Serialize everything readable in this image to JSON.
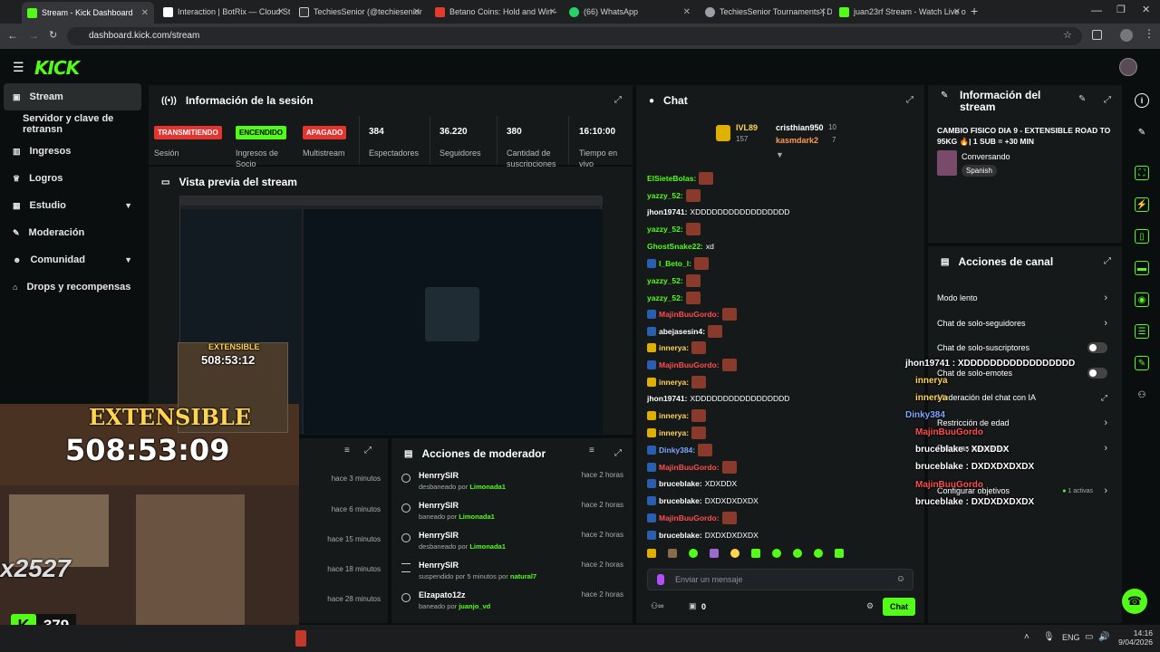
{
  "browser": {
    "tabs": [
      {
        "label": "Stream - Kick Dashboard",
        "color": "#53fc18"
      },
      {
        "label": "Interaction | BotRix — Cloud St",
        "color": "#ffffff"
      },
      {
        "label": "TechiesSenior (@techiesenior",
        "color": "#000000"
      },
      {
        "label": "Betano Coins: Hold and Win -",
        "color": "#e23b2b"
      },
      {
        "label": "(66) WhatsApp",
        "color": "#25d366"
      },
      {
        "label": "TechiesSenior Tournaments | D",
        "color": "#9aa0a6"
      },
      {
        "label": "juan23rf Stream - Watch Live o",
        "color": "#53fc18"
      }
    ],
    "url": "dashboard.kick.com/stream"
  },
  "brand": {
    "logo": "KICK",
    "accent": "#53fc18"
  },
  "sidebar": {
    "items": [
      {
        "label": "Stream",
        "icon": "stream-icon"
      },
      {
        "label": "Servidor y clave de retransn",
        "icon": ""
      },
      {
        "label": "Ingresos",
        "icon": "chart-icon"
      },
      {
        "label": "Logros",
        "icon": "trophy-icon"
      },
      {
        "label": "Estudio",
        "icon": "grid-icon"
      },
      {
        "label": "Moderación",
        "icon": "wrench-icon"
      },
      {
        "label": "Comunidad",
        "icon": "users-icon"
      },
      {
        "label": "Drops y recompensas",
        "icon": "gift-icon"
      }
    ]
  },
  "session": {
    "title": "Información de la sesión",
    "badges": [
      {
        "badge": "TRANSMITIENDO",
        "label": "Sesión"
      },
      {
        "badge": "ENCENDIDO",
        "label": "Ingresos de Socio"
      },
      {
        "badge": "APAGADO",
        "label": "Multistream"
      }
    ],
    "stats": [
      {
        "value": "384",
        "label": "Espectadores"
      },
      {
        "value": "36.220",
        "label": "Seguidores"
      },
      {
        "value": "380",
        "label": "Cantidad de suscripciones"
      },
      {
        "value": "16:10:00",
        "label": "Tiempo en vivo"
      }
    ]
  },
  "preview": {
    "title": "Vista previa del stream"
  },
  "overlay": {
    "timer_small": "508:53:12",
    "extensible": "EXTENSIBLE",
    "timer_big": "508:53:09",
    "counter": "x2527",
    "kick_count": "379",
    "float_chat": [
      {
        "user": "jhon19741",
        "msg": "XDDDDDDDDDDDDDDDDD",
        "color": "#ffffff"
      },
      {
        "user": "innerya",
        "msg": "",
        "color": "#ffd54f"
      },
      {
        "user": "innerya",
        "msg": "",
        "color": "#ffd54f"
      },
      {
        "user": "Dinky384",
        "msg": "",
        "color": "#7ea6ff"
      },
      {
        "user": "MajinBuuGordo",
        "msg": "",
        "color": "#ff4d4d"
      },
      {
        "user": "bruceblake",
        "msg": "XDXDDX",
        "color": "#ffffff"
      },
      {
        "user": "bruceblake",
        "msg": "DXDXDXDXDX",
        "color": "#ffffff"
      },
      {
        "user": "MajinBuuGordo",
        "msg": "",
        "color": "#ff4d4d"
      },
      {
        "user": "bruceblake",
        "msg": "DXDXDXDXDX",
        "color": "#ffffff"
      }
    ]
  },
  "timeline": {
    "rows": [
      "hace 3 minutos",
      "hace 6 minutos",
      "hace 15 minutos",
      "hace 18 minutos",
      "hace 28 minutos"
    ]
  },
  "modactions": {
    "title": "Acciones de moderador",
    "rows": [
      {
        "name": "HenrrySIR",
        "desc": "desbaneado por",
        "by": "Limonada1",
        "time": "hace 2 horas"
      },
      {
        "name": "HenrrySIR",
        "desc": "baneado por",
        "by": "Limonada1",
        "time": "hace 2 horas"
      },
      {
        "name": "HenrrySIR",
        "desc": "desbaneado por",
        "by": "Limonada1",
        "time": "hace 2 horas"
      },
      {
        "name": "HenrrySIR",
        "desc": "suspendido por 5 minutos por",
        "by": "natural7",
        "time": "hace 2 horas"
      },
      {
        "name": "Elzapato12z",
        "desc": "baneado por",
        "by": "juanjo_vd",
        "time": "hace 2 horas"
      }
    ]
  },
  "chat": {
    "title": "Chat",
    "top": {
      "level": "IVL89",
      "level_sub": "157",
      "user1": "cristhian950",
      "user1_n": "10",
      "user2": "kasmdark2",
      "user2_n": "7"
    },
    "messages": [
      {
        "user": "ElSieteBolas:",
        "msg": "",
        "color": "#53fc18"
      },
      {
        "user": "yazzy_52:",
        "msg": "",
        "color": "#53fc18"
      },
      {
        "user": "jhon19741:",
        "msg": "XDDDDDDDDDDDDDDDDD",
        "color": "#ffffff"
      },
      {
        "user": "yazzy_52:",
        "msg": "",
        "color": "#53fc18"
      },
      {
        "user": "GhostSnake22:",
        "msg": "xd",
        "color": "#53fc18"
      },
      {
        "user": "I_Beto_I:",
        "msg": "",
        "color": "#53fc18"
      },
      {
        "user": "yazzy_52:",
        "msg": "",
        "color": "#53fc18"
      },
      {
        "user": "yazzy_52:",
        "msg": "",
        "color": "#53fc18"
      },
      {
        "user": "MajinBuuGordo:",
        "msg": "",
        "color": "#ff4d4d"
      },
      {
        "user": "abejasesin4:",
        "msg": "",
        "color": "#ffffff"
      },
      {
        "user": "innerya:",
        "msg": "",
        "color": "#ffd54f"
      },
      {
        "user": "MajinBuuGordo:",
        "msg": "",
        "color": "#ff4d4d"
      },
      {
        "user": "innerya:",
        "msg": "",
        "color": "#ffd54f"
      },
      {
        "user": "jhon19741:",
        "msg": "XDDDDDDDDDDDDDDDDD",
        "color": "#ffffff"
      },
      {
        "user": "innerya:",
        "msg": "",
        "color": "#ffd54f"
      },
      {
        "user": "innerya:",
        "msg": "",
        "color": "#ffd54f"
      },
      {
        "user": "Dinky384:",
        "msg": "",
        "color": "#7ea6ff"
      },
      {
        "user": "MajinBuuGordo:",
        "msg": "",
        "color": "#ff4d4d"
      },
      {
        "user": "bruceblake:",
        "msg": "XDXDDX",
        "color": "#ffffff"
      },
      {
        "user": "bruceblake:",
        "msg": "DXDXDXDXDX",
        "color": "#ffffff"
      },
      {
        "user": "MajinBuuGordo:",
        "msg": "",
        "color": "#ff4d4d"
      },
      {
        "user": "bruceblake:",
        "msg": "DXDXDXDXDX",
        "color": "#ffffff"
      }
    ],
    "input_placeholder": "Enviar un mensaje",
    "points": "0",
    "send_label": "Chat"
  },
  "streaminfo": {
    "title": "Información del stream",
    "stream_title": "CAMBIO FISICO DIA 9 - EXTENSIBLE ROAD TO 95KG 🔥| 1 SUB = +30 MIN",
    "category": "Conversando",
    "language": "Spanish"
  },
  "channelactions": {
    "title": "Acciones de canal",
    "items": [
      {
        "label": "Modo lento",
        "control": "arrow"
      },
      {
        "label": "Chat de solo-seguidores",
        "control": "arrow"
      },
      {
        "label": "Chat de solo-suscriptores",
        "control": "toggle"
      },
      {
        "label": "Chat de solo-emotes",
        "control": "toggle"
      },
      {
        "label": "Moderación del chat con IA",
        "control": "external"
      },
      {
        "label": "Restricción de edad",
        "control": "arrow"
      },
      {
        "label": "Palabras baneadas",
        "control": "arrow"
      },
      {
        "label": "Configurar objetivos",
        "control": "arrow"
      }
    ],
    "active_label": "1 activas"
  },
  "taskbar": {
    "lang": "ENG",
    "time": "14:16",
    "date": "9/04/2026"
  }
}
